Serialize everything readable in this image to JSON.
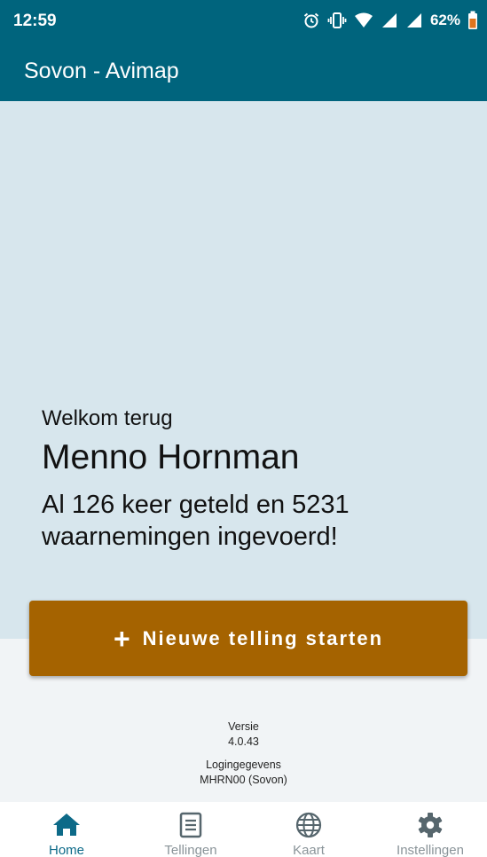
{
  "status_bar": {
    "time": "12:59",
    "battery": "62%",
    "icons": [
      "alarm-icon",
      "vibrate-icon",
      "wifi-icon",
      "signal-icon",
      "signal-icon",
      "battery-icon"
    ]
  },
  "app_bar": {
    "title": "Sovon - Avimap"
  },
  "welcome": {
    "subtitle": "Welkom terug",
    "name": "Menno Hornman",
    "stats": "Al 126 keer geteld en 5231 waarnemingen ingevoerd!"
  },
  "start_button": {
    "icon": "plus-icon",
    "label": "Nieuwe telling starten"
  },
  "info": {
    "version_label": "Versie",
    "version_value": "4.0.43",
    "login_label": "Logingegevens",
    "login_value": "MHRN00 (Sovon)"
  },
  "nav": {
    "items": [
      {
        "label": "Home",
        "icon": "home-icon",
        "active": true
      },
      {
        "label": "Tellingen",
        "icon": "document-icon",
        "active": false
      },
      {
        "label": "Kaart",
        "icon": "globe-icon",
        "active": false
      },
      {
        "label": "Instellingen",
        "icon": "gear-icon",
        "active": false
      }
    ]
  },
  "colors": {
    "primary": "#00647d",
    "accent": "#a56300",
    "hero_bg": "#d7e6ed",
    "nav_active": "#0d6a88",
    "nav_inactive": "#8a9499"
  }
}
